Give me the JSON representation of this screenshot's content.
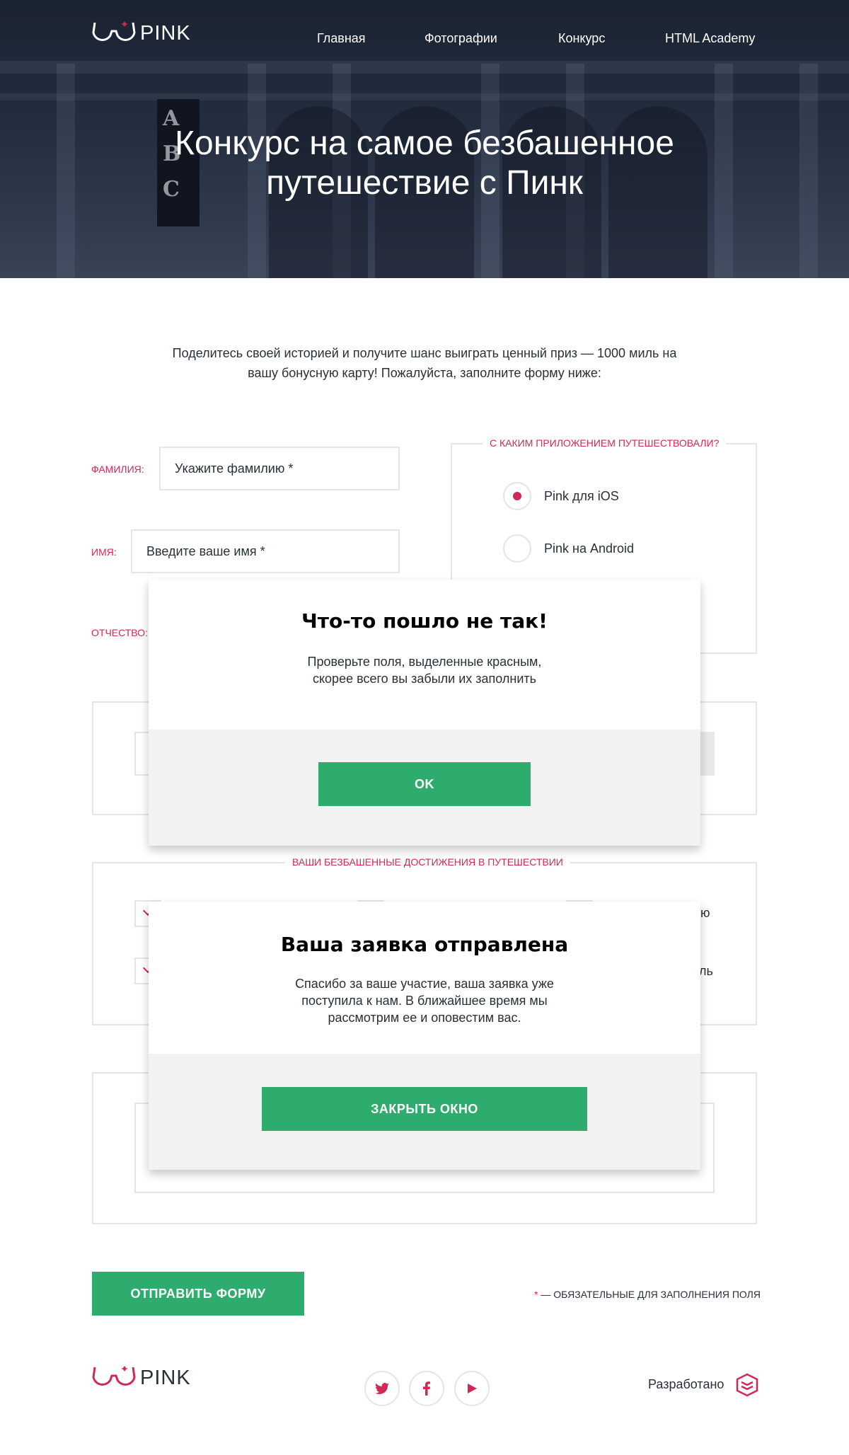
{
  "brand": {
    "name": "PINK",
    "accent": "#d22856",
    "green": "#2eac6d"
  },
  "nav": {
    "items": [
      "Главная",
      "Фотографии",
      "Конкурс",
      "HTML Academy"
    ]
  },
  "hero": {
    "title_line1": "Конкурс на самое безбашенное",
    "title_line2": "путешествие с Пинк",
    "sign_letters": [
      "A",
      "B",
      "C"
    ]
  },
  "intro": {
    "line1": "Поделитесь своей историей и получите шанс выиграть ценный приз — 1000 миль на",
    "line2": "вашу бонусную карту! Пожалуйста, заполните форму ниже:"
  },
  "form": {
    "surname": {
      "label": "Фамилия:",
      "placeholder": "Укажите фамилию *"
    },
    "name": {
      "label": "Имя:",
      "placeholder": "Введите ваше имя *"
    },
    "patronymic": {
      "label": "Отчество:"
    },
    "app_group": {
      "legend": "С каким приложением путешествовали?",
      "options": [
        "Pink для iOS",
        "Pink на Android"
      ],
      "selected": 0
    },
    "achievements": {
      "legend": "Ваши безбашенные достижения в путешествии",
      "partial_1": "ю",
      "partial_2": "ль"
    },
    "submit_label": "Отправить форму",
    "required_note": "— обязательные для заполнения поля",
    "required_star": "*"
  },
  "modal_error": {
    "title": "Что-то пошло не так!",
    "text_line1": "Проверьте поля, выделенные красным,",
    "text_line2": "скорее всего вы забыли их заполнить",
    "button": "OK"
  },
  "modal_success": {
    "title": "Ваша заявка отправлена",
    "text_line1": "Спасибо за ваше участие, ваша заявка уже",
    "text_line2": "поступила к нам. В ближайшее время мы",
    "text_line3": "рассмотрим ее и оповестим вас.",
    "button": "Закрыть окно"
  },
  "footer": {
    "developed": "Разработано",
    "social": [
      "twitter-icon",
      "facebook-icon",
      "youtube-icon"
    ]
  }
}
